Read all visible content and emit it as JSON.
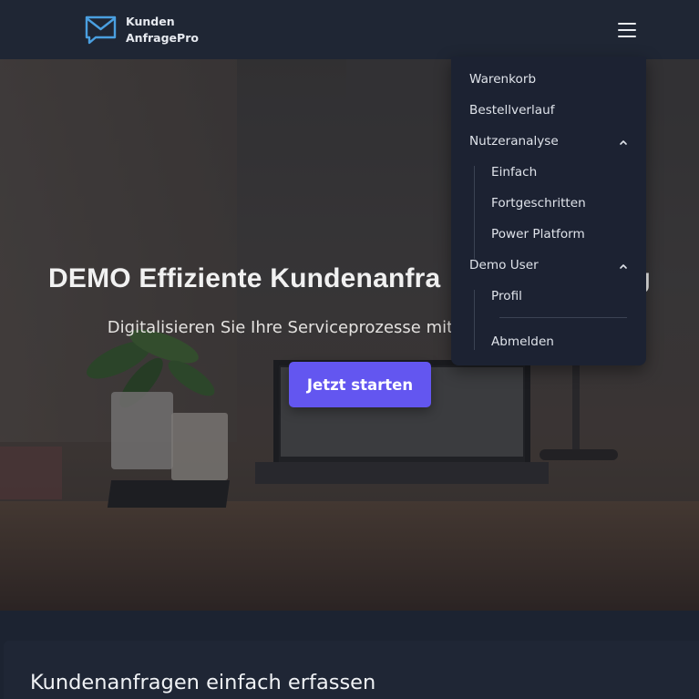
{
  "brand": {
    "line1": "Kunden",
    "line2": "AnfragePro",
    "accent": "#4a9fe0"
  },
  "hero": {
    "title": "DEMO Effiziente Kundenanfra",
    "title_tail": "g",
    "subtitle": "Digitalisieren Sie Ihre Serviceprozesse mit",
    "cta_label": "Jetzt starten",
    "cta_color": "#6356f0"
  },
  "menu": {
    "items": [
      {
        "label": "Warenkorb"
      },
      {
        "label": "Bestellverlauf"
      },
      {
        "label": "Nutzeranalyse",
        "expanded": true,
        "children": [
          {
            "label": "Einfach"
          },
          {
            "label": "Fortgeschritten"
          },
          {
            "label": "Power Platform"
          }
        ]
      },
      {
        "label": "Demo User",
        "expanded": true,
        "children": [
          {
            "label": "Profil"
          },
          {
            "label": "Abmelden"
          }
        ]
      }
    ]
  },
  "section": {
    "title": "Kundenanfragen einfach erfassen"
  },
  "icons": {
    "logo": "envelope-chat-icon",
    "menu": "hamburger-icon",
    "expand": "chevron-up-icon"
  }
}
